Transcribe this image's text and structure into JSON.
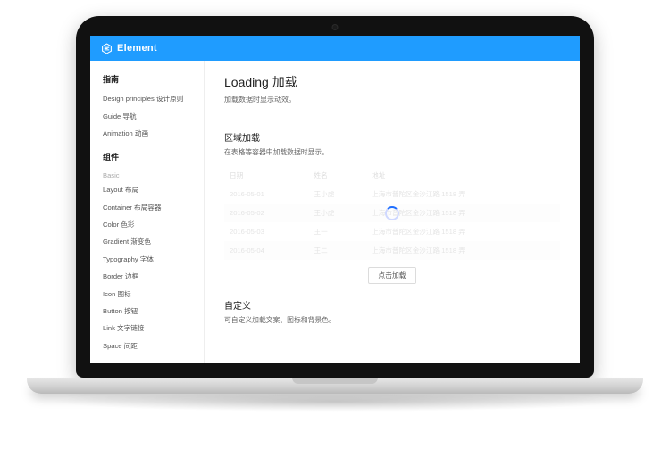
{
  "brand": "Element",
  "sidebar": {
    "section1": {
      "title": "指南",
      "items": [
        "Design principles  设计原则",
        "Guide 导航",
        "Animation 动画"
      ]
    },
    "section2": {
      "title": "组件",
      "subhead": "Basic",
      "items": [
        "Layout 布局",
        "Container 布局容器",
        "Color 色彩",
        "Gradient 渐变色",
        "Typography 字体",
        "Border 边框",
        "Icon 图标",
        "Button 按钮",
        "Link 文字链接",
        "Space 间距"
      ]
    }
  },
  "page": {
    "title": "Loading 加载",
    "desc": "加载数据时显示动效。",
    "section1": {
      "title": "区域加载",
      "desc": "在表格等容器中加载数据时显示。",
      "table": {
        "headers": [
          "日期",
          "姓名",
          "地址"
        ],
        "rows": [
          [
            "2016-05-01",
            "王小虎",
            "上海市普陀区金沙江路 1518 弄"
          ],
          [
            "2016-05-02",
            "王小虎",
            "上海市普陀区金沙江路 1518 弄"
          ],
          [
            "2016-05-03",
            "王一",
            "上海市普陀区金沙江路 1518 弄"
          ],
          [
            "2016-05-04",
            "王二",
            "上海市普陀区金沙江路 1518 弄"
          ]
        ]
      },
      "button": "点击加载"
    },
    "section2": {
      "title": "自定义",
      "desc": "可自定义加载文案、图标和背景色。"
    }
  }
}
